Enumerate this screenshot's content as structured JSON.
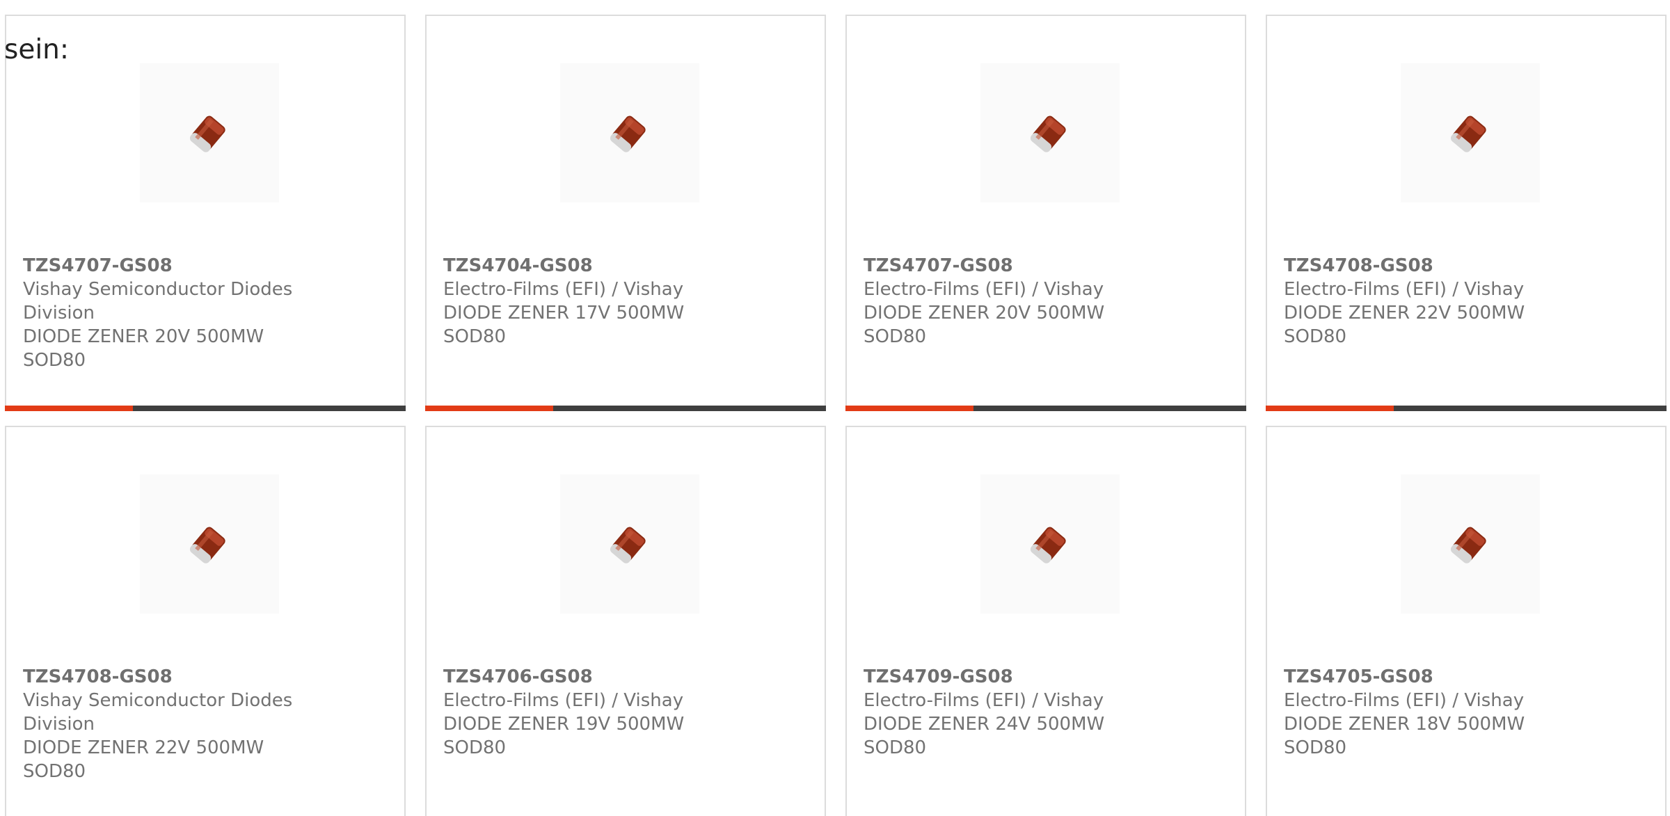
{
  "heading": "sein:",
  "colors": {
    "accent": "#e23b16",
    "bar": "#3f3f3f",
    "text": "#727272",
    "border": "#dcdcdc"
  },
  "image_icon": "diode-sod80-icon",
  "products": [
    {
      "part": "TZS4707-GS08",
      "manufacturer": "Vishay Semiconductor Diodes Division",
      "description": "DIODE ZENER 20V 500MW",
      "package": "SOD80"
    },
    {
      "part": "TZS4704-GS08",
      "manufacturer": "Electro-Films (EFI) / Vishay",
      "description": "DIODE ZENER 17V 500MW",
      "package": "SOD80"
    },
    {
      "part": "TZS4707-GS08",
      "manufacturer": "Electro-Films (EFI) / Vishay",
      "description": "DIODE ZENER 20V 500MW",
      "package": "SOD80"
    },
    {
      "part": "TZS4708-GS08",
      "manufacturer": "Electro-Films (EFI) / Vishay",
      "description": "DIODE ZENER 22V 500MW",
      "package": "SOD80"
    },
    {
      "part": "TZS4708-GS08",
      "manufacturer": "Vishay Semiconductor Diodes Division",
      "description": "DIODE ZENER 22V 500MW",
      "package": "SOD80"
    },
    {
      "part": "TZS4706-GS08",
      "manufacturer": "Electro-Films (EFI) / Vishay",
      "description": "DIODE ZENER 19V 500MW",
      "package": "SOD80"
    },
    {
      "part": "TZS4709-GS08",
      "manufacturer": "Electro-Films (EFI) / Vishay",
      "description": "DIODE ZENER 24V 500MW",
      "package": "SOD80"
    },
    {
      "part": "TZS4705-GS08",
      "manufacturer": "Electro-Films (EFI) / Vishay",
      "description": "DIODE ZENER 18V 500MW",
      "package": "SOD80"
    }
  ]
}
